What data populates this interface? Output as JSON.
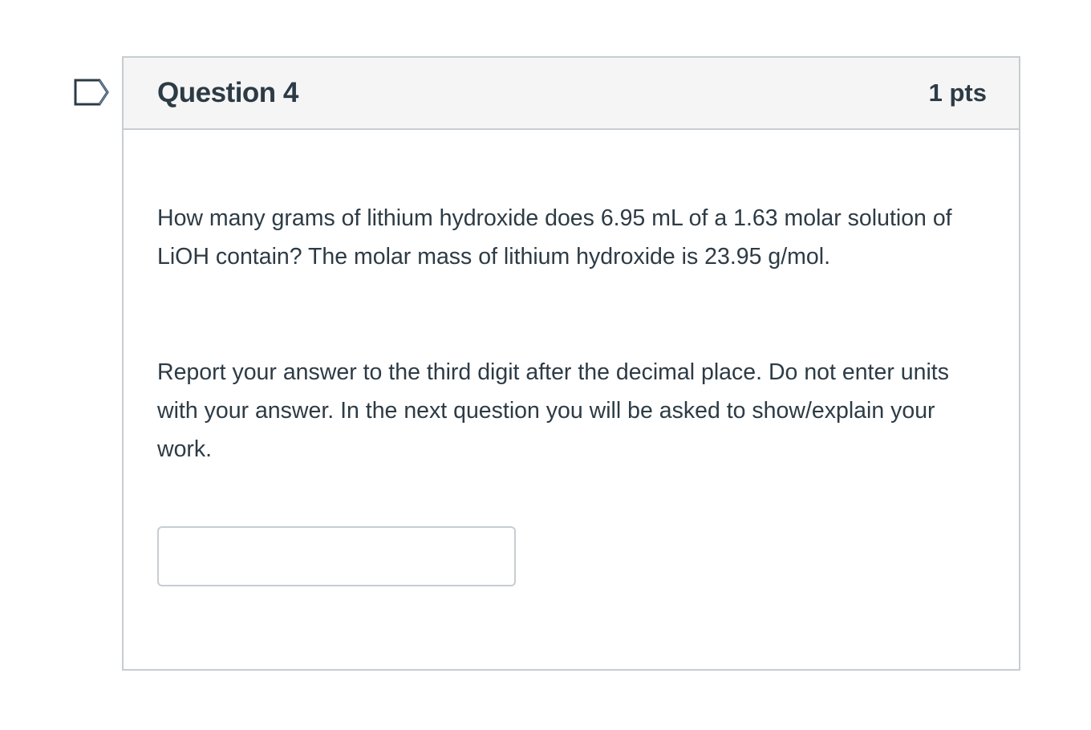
{
  "question": {
    "title": "Question 4",
    "points": "1 pts",
    "paragraphs": [
      "How many grams of lithium hydroxide does 6.95 mL of a 1.63 molar solution of LiOH contain? The molar mass of lithium hydroxide is 23.95 g/mol.",
      "Report your answer to the third digit after the decimal place. Do not enter units with your answer. In the next question you will be asked to show/explain your work."
    ],
    "answer": {
      "value": "",
      "placeholder": ""
    }
  },
  "icons": {
    "flag": "flag-bookmark-icon"
  },
  "colors": {
    "text": "#2d3b45",
    "border": "#c7cdd1",
    "header_bg": "#f5f5f5",
    "flag_stroke": "#2d3b45",
    "flag_fill_hint": "#6b8bb0"
  }
}
